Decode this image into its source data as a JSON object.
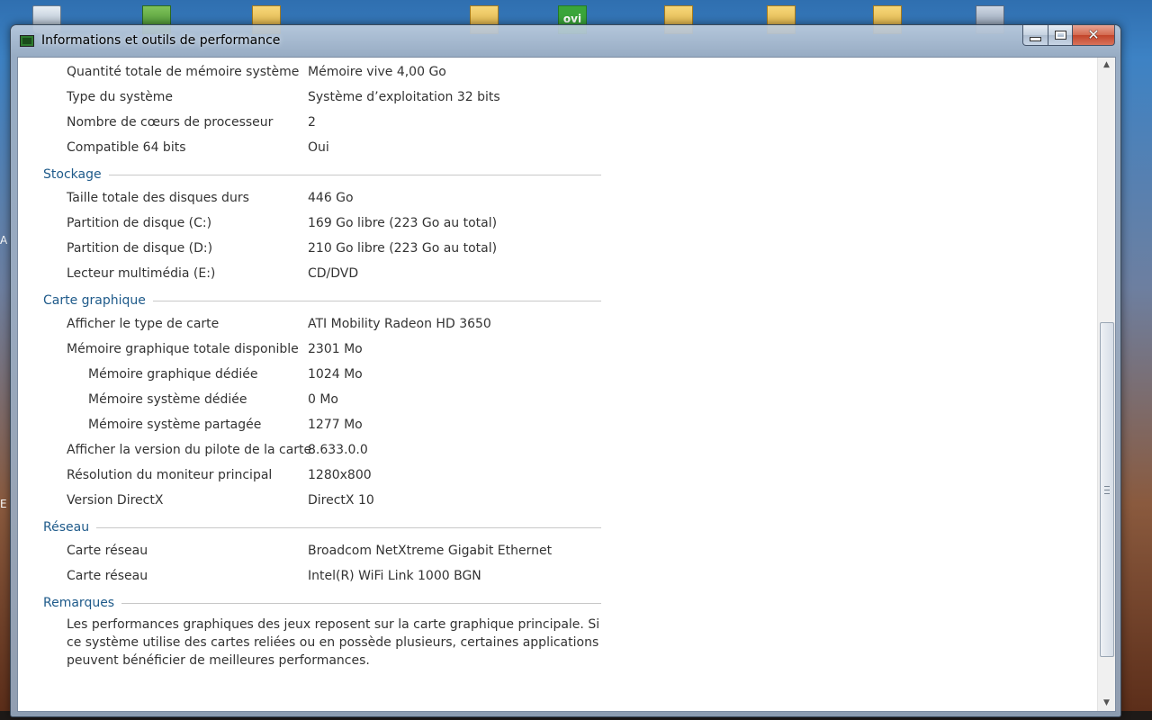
{
  "window": {
    "title": "Informations et outils de performance"
  },
  "caption": {
    "minimize": "minimize",
    "maximize": "maximize",
    "close": "✕"
  },
  "desktop": {
    "ovi_label": "ovi",
    "left_marks": [
      "A",
      "E"
    ]
  },
  "rows_top": [
    {
      "label": "Quantité totale de mémoire système",
      "value": "Mémoire vive 4,00 Go"
    },
    {
      "label": "Type du système",
      "value": "Système d’exploitation 32 bits"
    },
    {
      "label": "Nombre de cœurs de processeur",
      "value": "2"
    },
    {
      "label": "Compatible 64 bits",
      "value": "Oui"
    }
  ],
  "sections": {
    "storage": {
      "title": "Stockage",
      "rows": [
        {
          "label": "Taille totale des disques durs",
          "value": "446 Go"
        },
        {
          "label": "Partition de disque (C:)",
          "value": "169 Go libre (223 Go au total)"
        },
        {
          "label": "Partition de disque (D:)",
          "value": "210 Go libre (223 Go au total)"
        },
        {
          "label": "Lecteur multimédia (E:)",
          "value": "CD/DVD"
        }
      ]
    },
    "graphics": {
      "title": "Carte graphique",
      "rows": [
        {
          "label": "Afficher le type de carte",
          "value": "ATI Mobility Radeon HD 3650"
        },
        {
          "label": "Mémoire graphique totale disponible",
          "value": "2301 Mo"
        },
        {
          "label": "Mémoire graphique dédiée",
          "value": "1024 Mo"
        },
        {
          "label": "Mémoire système dédiée",
          "value": "0 Mo"
        },
        {
          "label": "Mémoire système partagée",
          "value": "1277 Mo"
        },
        {
          "label": "Afficher la version du pilote de la carte",
          "value": "8.633.0.0"
        },
        {
          "label": "Résolution du moniteur principal",
          "value": "1280x800"
        },
        {
          "label": "Version DirectX",
          "value": "DirectX 10"
        }
      ]
    },
    "network": {
      "title": "Réseau",
      "rows": [
        {
          "label": "Carte réseau",
          "value": "Broadcom NetXtreme Gigabit Ethernet"
        },
        {
          "label": "Carte réseau",
          "value": "Intel(R) WiFi Link 1000 BGN"
        }
      ]
    },
    "remarks": {
      "title": "Remarques",
      "text": "Les performances graphiques des jeux reposent sur la carte graphique principale. Si ce système utilise des cartes reliées ou en possède plusieurs, certaines applications peuvent bénéficier de meilleures performances."
    }
  },
  "scrollbar": {
    "up_arrow": "▲",
    "down_arrow": "▼",
    "scroll_position_fraction": 0.56
  }
}
